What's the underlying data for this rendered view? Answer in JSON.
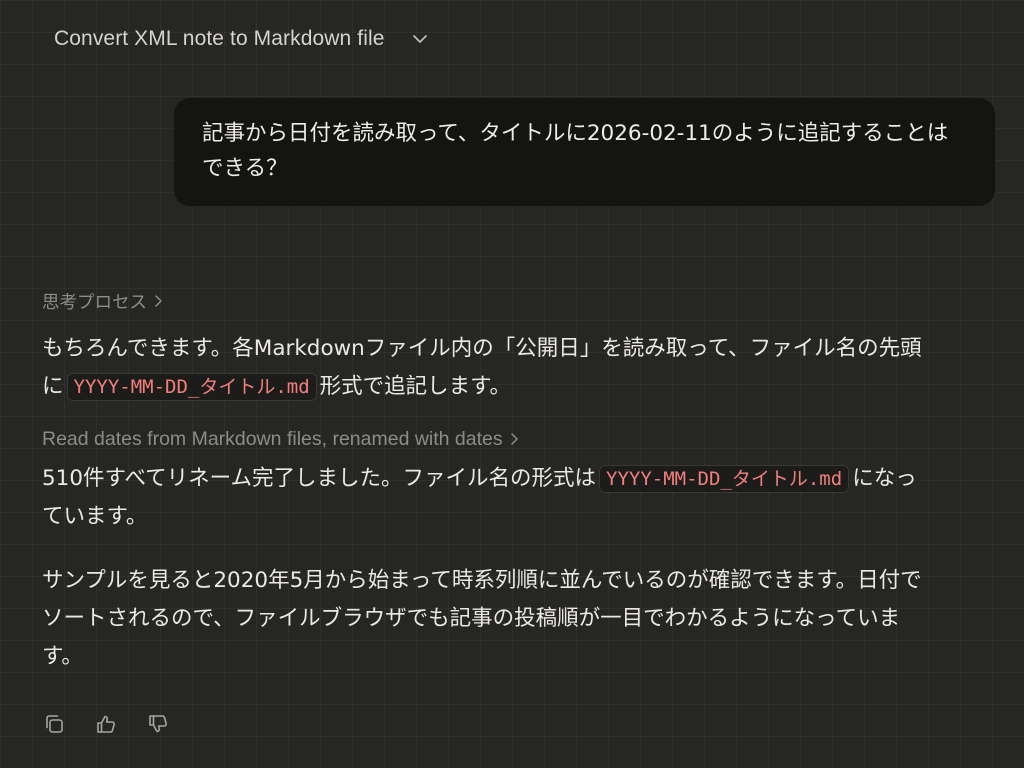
{
  "header": {
    "title": "Convert XML note to Markdown file",
    "chevron_icon": "chevron-down-icon"
  },
  "user_message": {
    "text": "記事から日付を読み取って、タイトルに2026-02-11のように追記することはできる？"
  },
  "assistant": {
    "thinking_label": "思考プロセス",
    "paragraph1": {
      "before": "もちろんできます。各Markdownファイル内の「公開日」を読み取って、ファイル名の先頭に",
      "code": "YYYY-MM-DD_タイトル.md",
      "after": "形式で追記します。"
    },
    "tool_label": "Read dates from Markdown files, renamed with dates",
    "paragraph2": {
      "before": "510件すべてリネーム完了しました。ファイル名の形式は",
      "code": "YYYY-MM-DD_タイトル.md",
      "after": "になっています。"
    },
    "paragraph3": "サンプルを見ると2020年5月から始まって時系列順に並んでいるのが確認できます。日付でソートされるので、ファイルブラウザでも記事の投稿順が一目でわかるようになっています。"
  },
  "actions": {
    "icons": [
      "copy-icon",
      "thumbs-up-icon",
      "thumbs-down-icon"
    ]
  },
  "colors": {
    "background": "#262624",
    "bubble": "#141413",
    "text": "#ece9e2",
    "muted": "#8f8c85",
    "code_text": "#f27f7a"
  }
}
